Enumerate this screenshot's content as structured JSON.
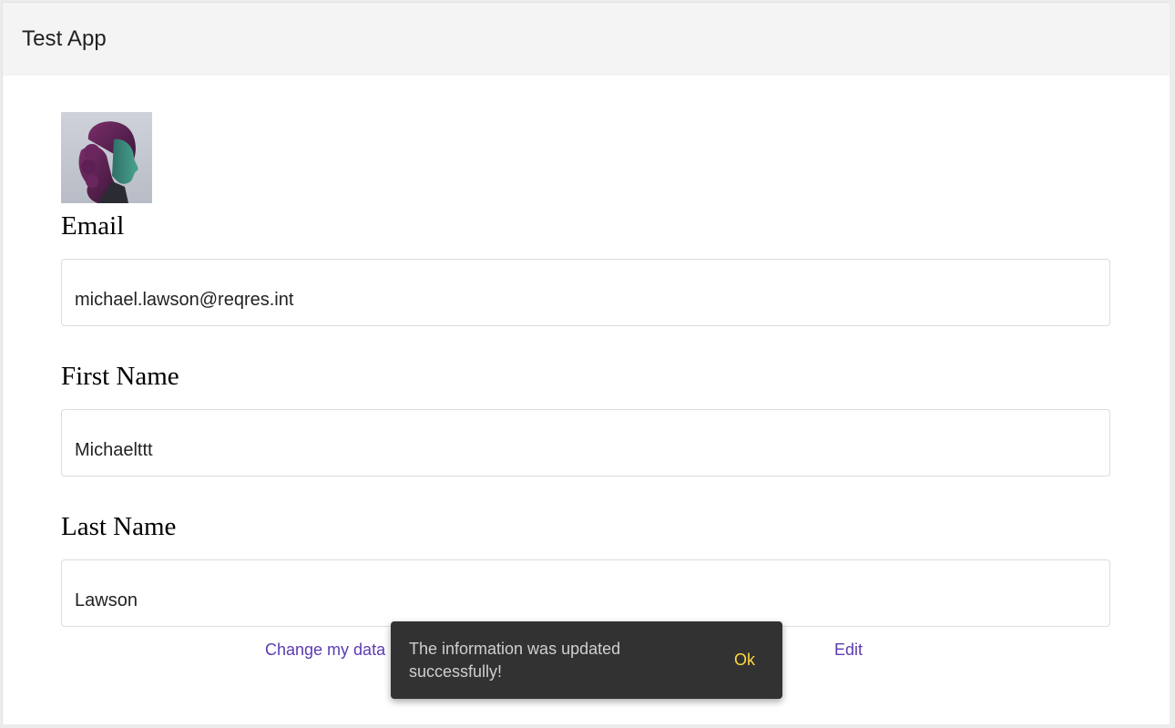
{
  "header": {
    "title": "Test App"
  },
  "profile": {
    "avatar_alt": "user avatar"
  },
  "form": {
    "email": {
      "label": "Email",
      "value": "michael.lawson@reqres.int"
    },
    "first_name": {
      "label": "First Name",
      "value": "Michaelttt"
    },
    "last_name": {
      "label": "Last Name",
      "value": "Lawson"
    }
  },
  "actions": {
    "change_label": "Change my data",
    "edit_label": "Edit"
  },
  "snackbar": {
    "message": "The information was updated successfully!",
    "action_label": "Ok"
  },
  "colors": {
    "link": "#5b3bb0",
    "snackbar_bg": "#323232",
    "snackbar_action": "#ffd740",
    "header_bg": "#f4f4f4"
  }
}
